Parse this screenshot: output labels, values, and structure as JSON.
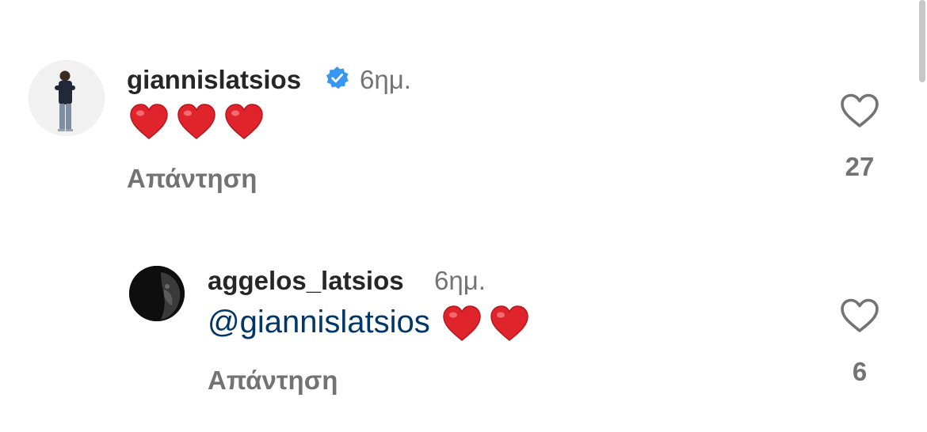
{
  "comments": [
    {
      "username": "giannislatsios",
      "verified": true,
      "time": "6ημ.",
      "mention": "",
      "emoji": [
        "heart",
        "heart",
        "heart"
      ],
      "reply_label": "Απάντηση",
      "likes": "27"
    },
    {
      "username": "aggelos_latsios",
      "verified": false,
      "time": "6ημ.",
      "mention": "@giannislatsios",
      "emoji": [
        "heart",
        "heart"
      ],
      "reply_label": "Απάντηση",
      "likes": "6"
    }
  ],
  "colors": {
    "username": "#262626",
    "secondary": "#737373",
    "mention": "#00376b",
    "verified": "#3897f0",
    "heart": "#e0242b"
  },
  "icons": {
    "verified": "verified-badge-icon",
    "like": "heart-outline-icon",
    "emoji": "red-heart-emoji"
  }
}
